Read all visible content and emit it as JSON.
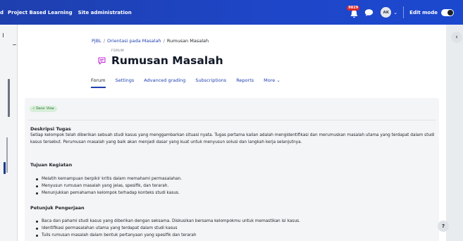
{
  "navbar": {
    "cut_item": "d",
    "items": [
      "Project Based Learning",
      "Site administration"
    ],
    "notification_count": "9829",
    "avatar_initials": "AK",
    "caret": "⌄",
    "edit_mode_label": "Edit mode"
  },
  "breadcrumb": {
    "items": [
      "PjBL",
      "Orientasi pada Masalah",
      "Rumusan Masalah"
    ],
    "separator": "/"
  },
  "page": {
    "kicker": "FORUM",
    "title": "Rumusan Masalah"
  },
  "tabs": [
    "Forum",
    "Settings",
    "Advanced grading",
    "Subscriptions",
    "Reports",
    "More ⌄"
  ],
  "completion": {
    "label": "✓ Done: View"
  },
  "sections": {
    "deskripsi": {
      "title": "Deskripsi Tugas",
      "text": "Setiap kelompok telah diberikan sebuah studi kasus yang menggambarkan situasi nyata. Tugas pertama kalian adalah mengidentifikasi dan merumuskan masalah utama yang terdapat dalam studi kasus tersebut. Perumusan masalah yang baik akan menjadi dasar yang kuat untuk menyusun solusi dan langkah kerja selanjutnya."
    },
    "tujuan": {
      "title": "Tujuan Kegiatan",
      "items": [
        "Melatih kemampuan berpikir kritis dalam memahami permasalahan.",
        "Menyusun rumusan masalah yang jelas, spesifik, dan terarah.",
        "Menunjukkan pemahaman kelompok terhadap konteks studi kasus."
      ]
    },
    "petunjuk": {
      "title": "Petunjuk Pengerjaan",
      "items": [
        "Baca dan pahami studi kasus yang diberikan dengan seksama. Diskusikan bersama kelompokmu untuk memastikan isi kasus.",
        "Identifikasi permasalahan utama yang terdapat dalam studi kasus",
        "Tulis rumusan masalah dalam bentuk pertanyaan yang spesifik dan terarah"
      ]
    }
  },
  "ui": {
    "drawer_toggle": "‹",
    "help": "?"
  }
}
